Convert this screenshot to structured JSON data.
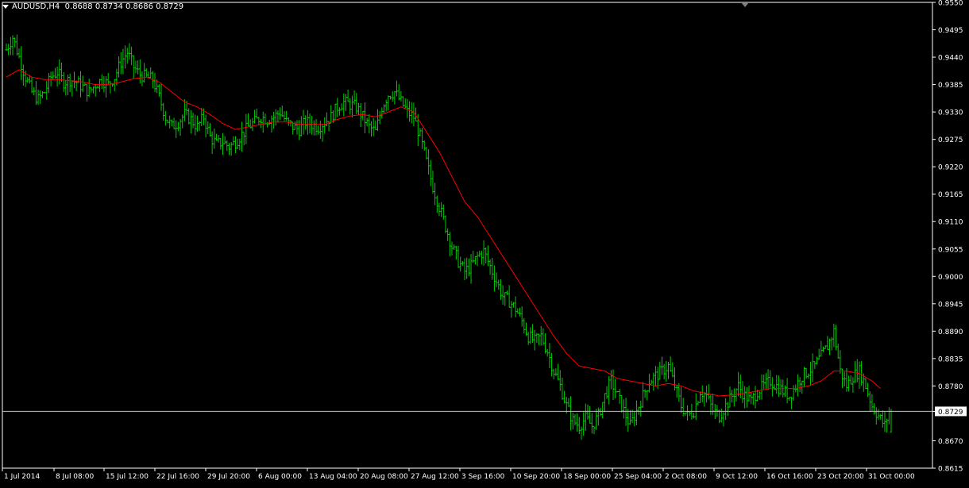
{
  "header": {
    "symbol": "AUDUSD,H4",
    "ohlc": "0.8688 0.8734 0.8686 0.8729"
  },
  "colors": {
    "background": "#000000",
    "grid_border": "#FFFFFF",
    "bars": "#00CC00",
    "moving_average": "#FF0000",
    "current_price_line": "#C0C0C0"
  },
  "chart_data": {
    "type": "ohlc-bar",
    "title": "AUDUSD,H4",
    "ylim": [
      0.8615,
      0.955
    ],
    "y_ticks": [
      "0.9550",
      "0.9495",
      "0.9440",
      "0.9385",
      "0.9330",
      "0.9275",
      "0.9220",
      "0.9165",
      "0.9110",
      "0.9055",
      "0.9000",
      "0.8945",
      "0.8890",
      "0.8835",
      "0.8780",
      "0.8729",
      "0.8670",
      "0.8615"
    ],
    "x_ticks": [
      "1 Jul 2014",
      "8 Jul 08:00",
      "15 Jul 12:00",
      "22 Jul 16:00",
      "29 Jul 20:00",
      "6 Aug 00:00",
      "13 Aug 04:00",
      "20 Aug 08:00",
      "27 Aug 12:00",
      "3 Sep 16:00",
      "10 Sep 20:00",
      "18 Sep 00:00",
      "25 Sep 04:00",
      "2 Oct 08:00",
      "9 Oct 12:00",
      "16 Oct 16:00",
      "23 Oct 20:00",
      "31 Oct 00:00"
    ],
    "current_price": 0.8729,
    "close_path": [
      [
        0,
        0.9455
      ],
      [
        3,
        0.948
      ],
      [
        6,
        0.944
      ],
      [
        9,
        0.94
      ],
      [
        12,
        0.937
      ],
      [
        15,
        0.9355
      ],
      [
        18,
        0.937
      ],
      [
        21,
        0.94
      ],
      [
        24,
        0.941
      ],
      [
        27,
        0.939
      ],
      [
        30,
        0.9395
      ],
      [
        33,
        0.939
      ],
      [
        36,
        0.938
      ],
      [
        39,
        0.937
      ],
      [
        42,
        0.9385
      ],
      [
        45,
        0.9395
      ],
      [
        48,
        0.9385
      ],
      [
        51,
        0.94
      ],
      [
        54,
        0.943
      ],
      [
        57,
        0.945
      ],
      [
        60,
        0.942
      ],
      [
        63,
        0.9405
      ],
      [
        66,
        0.94
      ],
      [
        69,
        0.9395
      ],
      [
        72,
        0.936
      ],
      [
        75,
        0.932
      ],
      [
        78,
        0.93
      ],
      [
        81,
        0.931
      ],
      [
        84,
        0.9325
      ],
      [
        87,
        0.9315
      ],
      [
        90,
        0.93
      ],
      [
        93,
        0.932
      ],
      [
        96,
        0.928
      ],
      [
        99,
        0.9265
      ],
      [
        102,
        0.927
      ],
      [
        105,
        0.926
      ],
      [
        108,
        0.927
      ],
      [
        111,
        0.9285
      ],
      [
        114,
        0.93
      ],
      [
        117,
        0.931
      ],
      [
        120,
        0.932
      ],
      [
        123,
        0.9315
      ],
      [
        126,
        0.932
      ],
      [
        129,
        0.933
      ],
      [
        132,
        0.931
      ],
      [
        135,
        0.93
      ],
      [
        138,
        0.9295
      ],
      [
        141,
        0.931
      ],
      [
        144,
        0.9305
      ],
      [
        147,
        0.93
      ],
      [
        150,
        0.931
      ],
      [
        153,
        0.932
      ],
      [
        156,
        0.934
      ],
      [
        159,
        0.935
      ],
      [
        162,
        0.9345
      ],
      [
        165,
        0.934
      ],
      [
        168,
        0.932
      ],
      [
        171,
        0.93
      ],
      [
        174,
        0.929
      ],
      [
        177,
        0.934
      ],
      [
        180,
        0.9365
      ],
      [
        183,
        0.937
      ],
      [
        186,
        0.935
      ],
      [
        189,
        0.933
      ],
      [
        192,
        0.932
      ],
      [
        195,
        0.928
      ],
      [
        198,
        0.923
      ],
      [
        201,
        0.918
      ],
      [
        204,
        0.914
      ],
      [
        207,
        0.91
      ],
      [
        210,
        0.906
      ],
      [
        213,
        0.903
      ],
      [
        216,
        0.901
      ],
      [
        219,
        0.902
      ],
      [
        222,
        0.904
      ],
      [
        225,
        0.905
      ],
      [
        228,
        0.902
      ],
      [
        231,
        0.899
      ],
      [
        234,
        0.896
      ],
      [
        237,
        0.895
      ],
      [
        240,
        0.8935
      ],
      [
        243,
        0.891
      ],
      [
        246,
        0.888
      ],
      [
        249,
        0.887
      ],
      [
        252,
        0.888
      ],
      [
        255,
        0.885
      ],
      [
        258,
        0.881
      ],
      [
        261,
        0.878
      ],
      [
        264,
        0.874
      ],
      [
        267,
        0.871
      ],
      [
        270,
        0.87
      ],
      [
        273,
        0.8715
      ],
      [
        276,
        0.87
      ],
      [
        279,
        0.872
      ],
      [
        282,
        0.876
      ],
      [
        285,
        0.879
      ],
      [
        288,
        0.876
      ],
      [
        291,
        0.873
      ],
      [
        294,
        0.87
      ],
      [
        297,
        0.873
      ],
      [
        300,
        0.876
      ],
      [
        303,
        0.879
      ],
      [
        306,
        0.88
      ],
      [
        309,
        0.881
      ],
      [
        312,
        0.882
      ],
      [
        315,
        0.878
      ],
      [
        318,
        0.874
      ],
      [
        321,
        0.872
      ],
      [
        324,
        0.873
      ],
      [
        327,
        0.877
      ],
      [
        330,
        0.876
      ],
      [
        333,
        0.873
      ],
      [
        336,
        0.872
      ],
      [
        339,
        0.874
      ],
      [
        342,
        0.876
      ],
      [
        345,
        0.878
      ],
      [
        348,
        0.876
      ],
      [
        351,
        0.875
      ],
      [
        354,
        0.877
      ],
      [
        357,
        0.878
      ],
      [
        360,
        0.879
      ],
      [
        363,
        0.878
      ],
      [
        366,
        0.877
      ],
      [
        369,
        0.876
      ],
      [
        372,
        0.878
      ],
      [
        375,
        0.88
      ],
      [
        378,
        0.881
      ],
      [
        381,
        0.882
      ],
      [
        384,
        0.884
      ],
      [
        387,
        0.886
      ],
      [
        390,
        0.889
      ],
      [
        393,
        0.881
      ],
      [
        396,
        0.878
      ],
      [
        399,
        0.88
      ],
      [
        402,
        0.881
      ],
      [
        405,
        0.878
      ],
      [
        408,
        0.874
      ],
      [
        411,
        0.872
      ],
      [
        414,
        0.87
      ],
      [
        416,
        0.8729
      ]
    ],
    "moving_average_path": [
      [
        0,
        0.94
      ],
      [
        6,
        0.9415
      ],
      [
        12,
        0.94
      ],
      [
        18,
        0.9395
      ],
      [
        24,
        0.9395
      ],
      [
        30,
        0.9393
      ],
      [
        36,
        0.939
      ],
      [
        42,
        0.9385
      ],
      [
        48,
        0.9385
      ],
      [
        54,
        0.939
      ],
      [
        60,
        0.9397
      ],
      [
        66,
        0.94
      ],
      [
        72,
        0.939
      ],
      [
        78,
        0.937
      ],
      [
        84,
        0.935
      ],
      [
        90,
        0.934
      ],
      [
        96,
        0.9325
      ],
      [
        102,
        0.9307
      ],
      [
        108,
        0.9295
      ],
      [
        114,
        0.93
      ],
      [
        120,
        0.9305
      ],
      [
        126,
        0.931
      ],
      [
        132,
        0.931
      ],
      [
        138,
        0.9305
      ],
      [
        144,
        0.9305
      ],
      [
        150,
        0.9305
      ],
      [
        156,
        0.9315
      ],
      [
        162,
        0.9322
      ],
      [
        168,
        0.9325
      ],
      [
        174,
        0.932
      ],
      [
        180,
        0.933
      ],
      [
        186,
        0.934
      ],
      [
        192,
        0.933
      ],
      [
        198,
        0.929
      ],
      [
        204,
        0.925
      ],
      [
        210,
        0.92
      ],
      [
        216,
        0.915
      ],
      [
        222,
        0.912
      ],
      [
        228,
        0.908
      ],
      [
        234,
        0.904
      ],
      [
        240,
        0.9
      ],
      [
        246,
        0.896
      ],
      [
        252,
        0.892
      ],
      [
        258,
        0.888
      ],
      [
        264,
        0.8845
      ],
      [
        270,
        0.882
      ],
      [
        276,
        0.8815
      ],
      [
        282,
        0.881
      ],
      [
        288,
        0.8795
      ],
      [
        294,
        0.879
      ],
      [
        300,
        0.8785
      ],
      [
        306,
        0.878
      ],
      [
        312,
        0.8785
      ],
      [
        318,
        0.878
      ],
      [
        324,
        0.877
      ],
      [
        330,
        0.8765
      ],
      [
        336,
        0.876
      ],
      [
        342,
        0.8762
      ],
      [
        348,
        0.8765
      ],
      [
        354,
        0.877
      ],
      [
        360,
        0.8775
      ],
      [
        366,
        0.8775
      ],
      [
        372,
        0.8775
      ],
      [
        378,
        0.878
      ],
      [
        384,
        0.879
      ],
      [
        390,
        0.881
      ],
      [
        396,
        0.881
      ],
      [
        402,
        0.8805
      ],
      [
        408,
        0.879
      ],
      [
        412,
        0.8775
      ]
    ]
  }
}
